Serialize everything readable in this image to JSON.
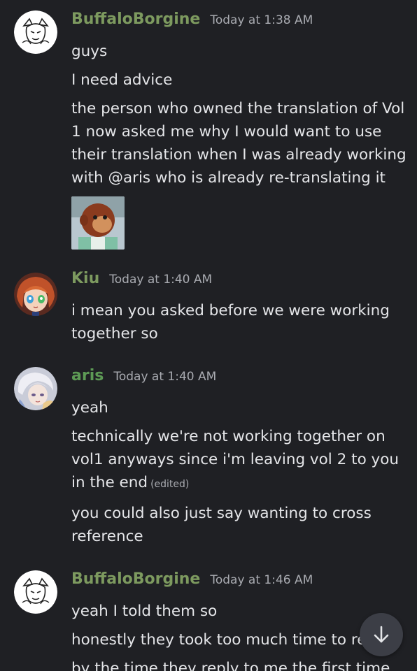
{
  "messages": [
    {
      "author": "BuffaloBorgine",
      "time": "Today at 1:38 AM",
      "lines": [
        "guys",
        "I need advice",
        "the person who owned the translation of Vol 1 now asked me why I would want to use their translation when I was already working with @aris who is already re-translating it"
      ],
      "attachment_icon": "monkey-puppet-meme-image"
    },
    {
      "author": "Kiu",
      "time": "Today at 1:40 AM",
      "lines": [
        "i mean you asked before we were working together so"
      ]
    },
    {
      "author": "aris",
      "time": "Today at 1:40 AM",
      "lines": [
        "yeah",
        "technically we're not working together on vol1 anyways since i'm leaving vol 2 to you in the end",
        "you could also just say wanting to cross reference"
      ],
      "edited_label": "(edited)"
    },
    {
      "author": "BuffaloBorgine",
      "time": "Today at 1:46 AM",
      "lines": [
        "yeah I told them so",
        "honestly they took too much time to re",
        "by the time they reply to me the first time,"
      ]
    }
  ],
  "scroll_button_icon": "arrow-down-icon",
  "colors": {
    "background": "#1f2024",
    "username": "#7d9a5f",
    "timestamp": "#a9abb1",
    "text": "#e4e5e8"
  }
}
